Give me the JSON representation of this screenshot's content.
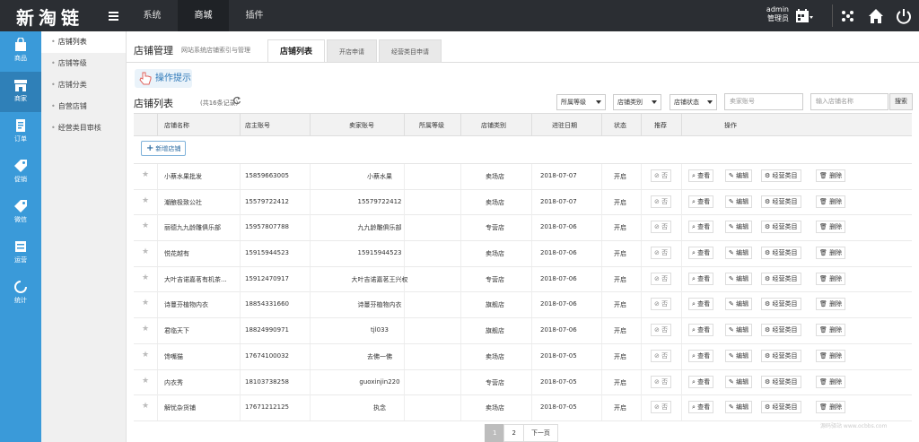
{
  "header": {
    "logo": "新淘链",
    "nav": [
      "系统",
      "商城",
      "插件"
    ],
    "user_name": "admin",
    "user_role": "管理员"
  },
  "sidebar": {
    "items": [
      {
        "label": "商品",
        "icon": "shopping-bag-icon"
      },
      {
        "label": "商家",
        "icon": "store-icon"
      },
      {
        "label": "订单",
        "icon": "order-icon"
      },
      {
        "label": "促销",
        "icon": "tag-icon"
      },
      {
        "label": "微信",
        "icon": "wechat-icon"
      },
      {
        "label": "运营",
        "icon": "operation-icon"
      },
      {
        "label": "统计",
        "icon": "stats-icon"
      }
    ]
  },
  "subnav": {
    "items": [
      "店铺列表",
      "店铺等级",
      "店铺分类",
      "自营店铺",
      "经营类目审核"
    ]
  },
  "page": {
    "title": "店铺管理",
    "subtitle": "网站系统店铺索引与管理",
    "tabs": [
      "店铺列表",
      "开店申请",
      "经营类目申请"
    ],
    "tip": "操作提示",
    "list_title": "店铺列表",
    "list_count": "(共16条记录)"
  },
  "filters": {
    "level": "所属等级",
    "category": "店铺类别",
    "status": "店铺状态",
    "seller_placeholder": "卖家账号",
    "shop_placeholder": "输入店铺名称",
    "search": "搜索"
  },
  "table": {
    "headers": [
      "店铺名称",
      "店主账号",
      "卖家账号",
      "所属等级",
      "店铺类别",
      "进驻日期",
      "状态",
      "推荐",
      "操作"
    ],
    "add_button": "新增店铺",
    "actions": [
      "查看",
      "编辑",
      "经营类目",
      "删除"
    ],
    "recommend_no": "否",
    "rows": [
      {
        "name": "小蔡水果批发",
        "owner": "15859663005",
        "seller": "小蔡水果",
        "level": "",
        "type": "卖场店",
        "date": "2018-07-07",
        "status": "开启"
      },
      {
        "name": "潮酿极致公社",
        "owner": "15579722412",
        "seller": "15579722412",
        "level": "",
        "type": "卖场店",
        "date": "2018-07-07",
        "status": "开启"
      },
      {
        "name": "丽德九九龄雕俱乐部",
        "owner": "15957807788",
        "seller": "九九龄雕俱乐部",
        "level": "",
        "type": "专营店",
        "date": "2018-07-06",
        "status": "开启"
      },
      {
        "name": "悦花越有",
        "owner": "15915944523",
        "seller": "15915944523",
        "level": "",
        "type": "卖场店",
        "date": "2018-07-06",
        "status": "开启"
      },
      {
        "name": "大叶吉诺嘉茗有机茶...",
        "owner": "15912470917",
        "seller": "大叶吉诺嘉茗王兴权",
        "level": "",
        "type": "专营店",
        "date": "2018-07-06",
        "status": "开启"
      },
      {
        "name": "诗蔓芬植物内衣",
        "owner": "18854331660",
        "seller": "诗蔓芬植物内衣",
        "level": "",
        "type": "旗舰店",
        "date": "2018-07-06",
        "status": "开启"
      },
      {
        "name": "君临天下",
        "owner": "18824990971",
        "seller": "tjl033",
        "level": "",
        "type": "旗舰店",
        "date": "2018-07-06",
        "status": "开启"
      },
      {
        "name": "馋嘴猫",
        "owner": "17674100032",
        "seller": "去佛一佛",
        "level": "",
        "type": "卖场店",
        "date": "2018-07-05",
        "status": "开启"
      },
      {
        "name": "内衣秀",
        "owner": "18103738258",
        "seller": "guoxinjin220",
        "level": "",
        "type": "专营店",
        "date": "2018-07-05",
        "status": "开启"
      },
      {
        "name": "解忧杂货铺",
        "owner": "17671212125",
        "seller": "执念",
        "level": "",
        "type": "卖场店",
        "date": "2018-07-05",
        "status": "开启"
      }
    ]
  },
  "pager": {
    "pages": [
      "1",
      "2"
    ],
    "next": "下一页"
  },
  "watermark": "源码驿站 www.ocbbs.com"
}
